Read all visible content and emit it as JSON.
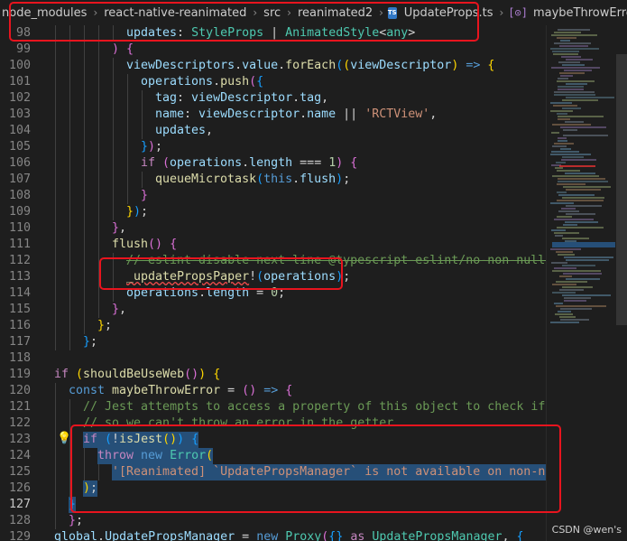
{
  "breadcrumb": {
    "items": [
      "node_modules",
      "react-native-reanimated",
      "src",
      "reanimated2",
      "UpdateProps.ts",
      "maybeThrowError"
    ],
    "file_badge": "TS",
    "symbol_glyph": "[⊙]"
  },
  "lines": [
    {
      "n": "98",
      "tokens": [
        [
          "v",
          "updates"
        ],
        [
          "p",
          ": "
        ],
        [
          "t",
          "StyleProps"
        ],
        [
          "p",
          " | "
        ],
        [
          "t",
          "AnimatedStyle"
        ],
        [
          "p",
          "<"
        ],
        [
          "t",
          "any"
        ],
        [
          "p",
          ">"
        ]
      ]
    },
    {
      "n": "99",
      "tokens": [
        [
          "br2",
          ")"
        ],
        [
          "p",
          " "
        ],
        [
          "br2",
          "{"
        ]
      ]
    },
    {
      "n": "100",
      "tokens": [
        [
          "v",
          "viewDescriptors"
        ],
        [
          "p",
          "."
        ],
        [
          "v",
          "value"
        ],
        [
          "p",
          "."
        ],
        [
          "f",
          "forEach"
        ],
        [
          "br3",
          "("
        ],
        [
          "br1",
          "("
        ],
        [
          "v",
          "viewDescriptor"
        ],
        [
          "br1",
          ")"
        ],
        [
          "p",
          " "
        ],
        [
          "kb",
          "=>"
        ],
        [
          "p",
          " "
        ],
        [
          "br1",
          "{"
        ]
      ]
    },
    {
      "n": "101",
      "tokens": [
        [
          "v",
          "operations"
        ],
        [
          "p",
          "."
        ],
        [
          "f",
          "push"
        ],
        [
          "br2",
          "("
        ],
        [
          "br3",
          "{"
        ]
      ]
    },
    {
      "n": "102",
      "tokens": [
        [
          "v",
          "tag"
        ],
        [
          "p",
          ": "
        ],
        [
          "v",
          "viewDescriptor"
        ],
        [
          "p",
          "."
        ],
        [
          "v",
          "tag"
        ],
        [
          "p",
          ","
        ]
      ]
    },
    {
      "n": "103",
      "tokens": [
        [
          "v",
          "name"
        ],
        [
          "p",
          ": "
        ],
        [
          "v",
          "viewDescriptor"
        ],
        [
          "p",
          "."
        ],
        [
          "v",
          "name"
        ],
        [
          "p",
          " || "
        ],
        [
          "s",
          "'RCTView'"
        ],
        [
          "p",
          ","
        ]
      ]
    },
    {
      "n": "104",
      "tokens": [
        [
          "v",
          "updates"
        ],
        [
          "p",
          ","
        ]
      ]
    },
    {
      "n": "105",
      "tokens": [
        [
          "br3",
          "}"
        ],
        [
          "br2",
          ")"
        ],
        [
          "p",
          ";"
        ]
      ]
    },
    {
      "n": "106",
      "tokens": [
        [
          "k",
          "if"
        ],
        [
          "p",
          " "
        ],
        [
          "br2",
          "("
        ],
        [
          "v",
          "operations"
        ],
        [
          "p",
          "."
        ],
        [
          "v",
          "length"
        ],
        [
          "p",
          " === "
        ],
        [
          "n",
          "1"
        ],
        [
          "br2",
          ")"
        ],
        [
          "p",
          " "
        ],
        [
          "br2",
          "{"
        ]
      ]
    },
    {
      "n": "107",
      "tokens": [
        [
          "f",
          "queueMicrotask"
        ],
        [
          "br3",
          "("
        ],
        [
          "kb",
          "this"
        ],
        [
          "p",
          "."
        ],
        [
          "v",
          "flush"
        ],
        [
          "br3",
          ")"
        ],
        [
          "p",
          ";"
        ]
      ]
    },
    {
      "n": "108",
      "tokens": [
        [
          "br2",
          "}"
        ]
      ]
    },
    {
      "n": "109",
      "tokens": [
        [
          "br1",
          "}"
        ],
        [
          "br3",
          ")"
        ],
        [
          "p",
          ";"
        ]
      ]
    },
    {
      "n": "110",
      "tokens": [
        [
          "br2",
          "}"
        ],
        [
          "p",
          ","
        ]
      ]
    },
    {
      "n": "111",
      "tokens": [
        [
          "f",
          "flush"
        ],
        [
          "br2",
          "("
        ],
        [
          "br2",
          ")"
        ],
        [
          "p",
          " "
        ],
        [
          "br2",
          "{"
        ]
      ]
    },
    {
      "n": "112",
      "tokens": [
        [
          "c",
          "// eslint-disable-next-line @typescript-eslint/no-non-null-assert"
        ]
      ]
    },
    {
      "n": "113",
      "tokens": [
        [
          "f",
          "_updatePropsPaper"
        ],
        [
          "p",
          "!"
        ],
        [
          "br3",
          "("
        ],
        [
          "v",
          "operations"
        ],
        [
          "br3",
          ")"
        ],
        [
          "p",
          ";"
        ]
      ]
    },
    {
      "n": "114",
      "tokens": [
        [
          "v",
          "operations"
        ],
        [
          "p",
          "."
        ],
        [
          "v",
          "length"
        ],
        [
          "p",
          " = "
        ],
        [
          "n",
          "0"
        ],
        [
          "p",
          ";"
        ]
      ]
    },
    {
      "n": "115",
      "tokens": [
        [
          "br2",
          "}"
        ],
        [
          "p",
          ","
        ]
      ]
    },
    {
      "n": "116",
      "tokens": [
        [
          "br1",
          "}"
        ],
        [
          "p",
          ";"
        ]
      ]
    },
    {
      "n": "117",
      "tokens": [
        [
          "br3",
          "}"
        ],
        [
          "p",
          ";"
        ]
      ]
    },
    {
      "n": "118",
      "tokens": []
    },
    {
      "n": "119",
      "tokens": [
        [
          "k",
          "if"
        ],
        [
          "p",
          " "
        ],
        [
          "br1",
          "("
        ],
        [
          "f",
          "shouldBeUseWeb"
        ],
        [
          "br2",
          "("
        ],
        [
          "br2",
          ")"
        ],
        [
          "br1",
          ")"
        ],
        [
          "p",
          " "
        ],
        [
          "br1",
          "{"
        ]
      ]
    },
    {
      "n": "120",
      "tokens": [
        [
          "kb",
          "const"
        ],
        [
          "p",
          " "
        ],
        [
          "f",
          "maybeThrowError"
        ],
        [
          "p",
          " = "
        ],
        [
          "br2",
          "("
        ],
        [
          "br2",
          ")"
        ],
        [
          "p",
          " "
        ],
        [
          "kb",
          "=>"
        ],
        [
          "p",
          " "
        ],
        [
          "br2",
          "{"
        ]
      ]
    },
    {
      "n": "121",
      "tokens": [
        [
          "c",
          "// Jest attempts to access a property of this object to check if it is a"
        ]
      ]
    },
    {
      "n": "122",
      "tokens": [
        [
          "c",
          "// so we can't throw an error in the getter."
        ]
      ]
    },
    {
      "n": "123",
      "tokens": [
        [
          "k",
          "if"
        ],
        [
          "p",
          " "
        ],
        [
          "br3",
          "("
        ],
        [
          "p",
          "!"
        ],
        [
          "f",
          "isJest"
        ],
        [
          "br1",
          "("
        ],
        [
          "br1",
          ")"
        ],
        [
          "br3",
          ")"
        ],
        [
          "p",
          " "
        ],
        [
          "br3",
          "{"
        ]
      ]
    },
    {
      "n": "124",
      "tokens": [
        [
          "k",
          "throw"
        ],
        [
          "p",
          " "
        ],
        [
          "kb",
          "new"
        ],
        [
          "p",
          " "
        ],
        [
          "t",
          "Error"
        ],
        [
          "br1",
          "("
        ]
      ]
    },
    {
      "n": "125",
      "tokens": [
        [
          "s",
          "'[Reanimated] `UpdatePropsManager` is not available on non-native p"
        ]
      ]
    },
    {
      "n": "126",
      "tokens": [
        [
          "br1",
          ")"
        ],
        [
          "p",
          ";"
        ]
      ]
    },
    {
      "n": "127",
      "tokens": [
        [
          "br3",
          "}"
        ]
      ]
    },
    {
      "n": "128",
      "tokens": [
        [
          "br2",
          "}"
        ],
        [
          "p",
          ";"
        ]
      ]
    },
    {
      "n": "129",
      "tokens": [
        [
          "v",
          "global"
        ],
        [
          "p",
          "."
        ],
        [
          "v",
          "UpdatePropsManager"
        ],
        [
          "p",
          " = "
        ],
        [
          "kb",
          "new"
        ],
        [
          "p",
          " "
        ],
        [
          "t",
          "Proxy"
        ],
        [
          "br2",
          "("
        ],
        [
          "br3",
          "{"
        ],
        [
          "br3",
          "}"
        ],
        [
          "p",
          " "
        ],
        [
          "k",
          "as"
        ],
        [
          "p",
          " "
        ],
        [
          "t",
          "UpdatePropsManager"
        ],
        [
          "p",
          ", "
        ],
        [
          "br3",
          "{"
        ]
      ]
    }
  ],
  "watermark": "CSDN @wen's",
  "lightbulb_glyph": "💡"
}
